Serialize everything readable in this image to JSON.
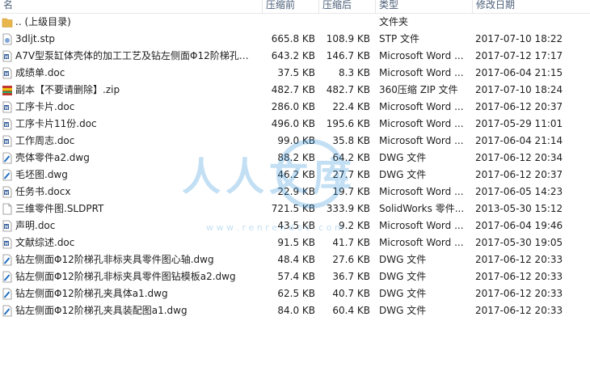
{
  "columns": {
    "name": "名",
    "compressed": "压缩前",
    "size": "压缩后",
    "type": "类型",
    "date": "修改日期"
  },
  "rows": [
    {
      "icon": "folder-up-icon",
      "name": ".. (上级目录)",
      "compressed": "",
      "size": "",
      "type": "文件夹",
      "date": ""
    },
    {
      "icon": "stp-file-icon",
      "name": "3dljt.stp",
      "compressed": "665.8 KB",
      "size": "108.9 KB",
      "type": "STP 文件",
      "date": "2017-07-10 18:22"
    },
    {
      "icon": "word-doc-icon",
      "name": "A7V型泵缸体壳体的加工工艺及钻左侧面Φ12阶梯孔夹...",
      "compressed": "643.2 KB",
      "size": "146.7 KB",
      "type": "Microsoft Word ...",
      "date": "2017-07-12 17:17"
    },
    {
      "icon": "word-doc-icon",
      "name": "成绩单.doc",
      "compressed": "37.5 KB",
      "size": "8.3 KB",
      "type": "Microsoft Word ...",
      "date": "2017-06-04 21:15"
    },
    {
      "icon": "zip-archive-icon",
      "name": "副本【不要请删除】.zip",
      "compressed": "482.7 KB",
      "size": "482.7 KB",
      "type": "360压缩 ZIP 文件",
      "date": "2017-07-10 18:24"
    },
    {
      "icon": "word-doc-icon",
      "name": "工序卡片.doc",
      "compressed": "286.0 KB",
      "size": "22.4 KB",
      "type": "Microsoft Word ...",
      "date": "2017-06-12 20:37"
    },
    {
      "icon": "word-doc-icon",
      "name": "工序卡片11份.doc",
      "compressed": "496.0 KB",
      "size": "195.6 KB",
      "type": "Microsoft Word ...",
      "date": "2017-05-29 11:01"
    },
    {
      "icon": "word-doc-icon",
      "name": "工作周志.doc",
      "compressed": "99.0 KB",
      "size": "35.8 KB",
      "type": "Microsoft Word ...",
      "date": "2017-06-04 21:14"
    },
    {
      "icon": "dwg-file-icon",
      "name": "壳体零件a2.dwg",
      "compressed": "88.2 KB",
      "size": "64.2 KB",
      "type": "DWG 文件",
      "date": "2017-06-12 20:34"
    },
    {
      "icon": "dwg-file-icon",
      "name": "毛坯图.dwg",
      "compressed": "46.2 KB",
      "size": "27.7 KB",
      "type": "DWG 文件",
      "date": "2017-06-12 20:37"
    },
    {
      "icon": "word-doc-icon",
      "name": "任务书.docx",
      "compressed": "22.9 KB",
      "size": "19.7 KB",
      "type": "Microsoft Word ...",
      "date": "2017-06-05 14:23"
    },
    {
      "icon": "blank-file-icon",
      "name": "三维零件图.SLDPRT",
      "compressed": "721.5 KB",
      "size": "333.9 KB",
      "type": "SolidWorks 零件...",
      "date": "2013-05-30 15:12"
    },
    {
      "icon": "word-doc-icon",
      "name": "声明.doc",
      "compressed": "43.5 KB",
      "size": "9.2 KB",
      "type": "Microsoft Word ...",
      "date": "2017-06-04 19:46"
    },
    {
      "icon": "word-doc-icon",
      "name": "文献综述.doc",
      "compressed": "91.5 KB",
      "size": "41.7 KB",
      "type": "Microsoft Word ...",
      "date": "2017-05-30 19:05"
    },
    {
      "icon": "dwg-file-icon",
      "name": "钻左侧面Φ12阶梯孔非标夹具零件图心轴.dwg",
      "compressed": "48.4 KB",
      "size": "27.6 KB",
      "type": "DWG 文件",
      "date": "2017-06-12 20:33"
    },
    {
      "icon": "dwg-file-icon",
      "name": "钻左侧面Φ12阶梯孔非标夹具零件图钻模板a2.dwg",
      "compressed": "57.4 KB",
      "size": "36.7 KB",
      "type": "DWG 文件",
      "date": "2017-06-12 20:33"
    },
    {
      "icon": "dwg-file-icon",
      "name": "钻左侧面Φ12阶梯孔夹具体a1.dwg",
      "compressed": "62.5 KB",
      "size": "40.7 KB",
      "type": "DWG 文件",
      "date": "2017-06-12 20:33"
    },
    {
      "icon": "dwg-file-icon",
      "name": "钻左侧面Φ12阶梯孔夹具装配图a1.dwg",
      "compressed": "84.0 KB",
      "size": "60.4 KB",
      "type": "DWG 文件",
      "date": "2017-06-12 20:33"
    }
  ],
  "watermark": {
    "text": "人人文库",
    "url": "w w w . r e n r e n d o c . c o m"
  },
  "colors": {
    "header_text": "#4c607a",
    "folder": "#e8b64a",
    "word": "#2b5797",
    "dwg": "#1f6fc4",
    "zip": "#c0392b",
    "watermark": "#2a8fd8"
  }
}
